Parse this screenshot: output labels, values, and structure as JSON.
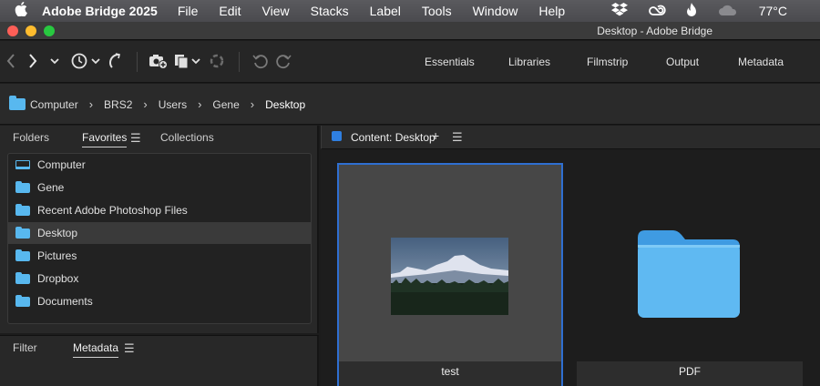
{
  "menubar": {
    "app_name": "Adobe Bridge 2025",
    "items": [
      "File",
      "Edit",
      "View",
      "Stacks",
      "Label",
      "Tools",
      "Window",
      "Help"
    ],
    "temperature": "77°C"
  },
  "window": {
    "title": "Desktop - Adobe Bridge"
  },
  "toolbar": {
    "workspaces": [
      "Essentials",
      "Libraries",
      "Filmstrip",
      "Output",
      "Metadata"
    ]
  },
  "breadcrumb": [
    "Computer",
    "BRS2",
    "Users",
    "Gene",
    "Desktop"
  ],
  "left_panel": {
    "tabs": {
      "folders": "Folders",
      "favorites": "Favorites",
      "collections": "Collections"
    },
    "favorites": [
      {
        "label": "Computer",
        "icon": "computer-icon"
      },
      {
        "label": "Gene",
        "icon": "folder-icon"
      },
      {
        "label": "Recent Adobe Photoshop Files",
        "icon": "folder-icon"
      },
      {
        "label": "Desktop",
        "icon": "folder-icon",
        "selected": true
      },
      {
        "label": "Pictures",
        "icon": "folder-icon"
      },
      {
        "label": "Dropbox",
        "icon": "folder-icon"
      },
      {
        "label": "Documents",
        "icon": "folder-icon"
      }
    ],
    "bottom_tabs": {
      "filter": "Filter",
      "metadata": "Metadata"
    }
  },
  "content": {
    "title": "Content: Desktop",
    "items": [
      {
        "label": "test",
        "type": "image",
        "selected": true
      },
      {
        "label": "PDF",
        "type": "folder"
      }
    ]
  },
  "colors": {
    "accent": "#2f6fd1",
    "folder": "#58b8ef"
  }
}
